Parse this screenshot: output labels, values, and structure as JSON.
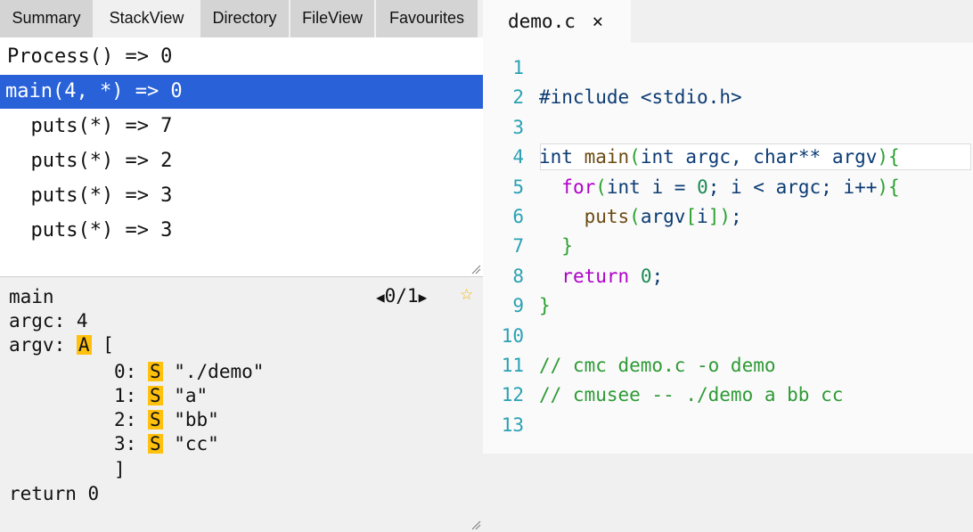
{
  "tabs": [
    "Summary",
    "StackView",
    "Directory",
    "FileView",
    "Favourites"
  ],
  "active_tab": "StackView",
  "stack": {
    "rows": [
      "Process() => 0",
      "main(4, *) => 0",
      "  puts(*) => 7",
      "  puts(*) => 2",
      "  puts(*) => 3",
      "  puts(*) => 3"
    ],
    "selected_index": 1
  },
  "vars": {
    "frame_name": "main",
    "nav_prev": "◀",
    "nav_value": "0/1",
    "nav_next": "▶",
    "star": "☆",
    "argc_label": "argc: ",
    "argc_value": "4",
    "argv_label": "argv: ",
    "argv_badge": "A",
    "argv_open": "[",
    "argv_items": [
      {
        "index": "0: ",
        "badge": "S",
        "value": "\"./demo\""
      },
      {
        "index": "1: ",
        "badge": "S",
        "value": "\"a\""
      },
      {
        "index": "2: ",
        "badge": "S",
        "value": "\"bb\""
      },
      {
        "index": "3: ",
        "badge": "S",
        "value": "\"cc\""
      }
    ],
    "argv_close": "]",
    "return_text": "return 0"
  },
  "editor": {
    "tab_label": "demo.c",
    "close_glyph": "×",
    "line_numbers": [
      "1",
      "2",
      "3",
      "4",
      "5",
      "6",
      "7",
      "8",
      "9",
      "10",
      "11",
      "12",
      "13"
    ],
    "current_line": 4,
    "code": {
      "l2_include": "#include",
      "l2_header": "<stdio.h>",
      "l4_int1": "int",
      "l4_main": "main",
      "l4_int2": "int",
      "l4_argc": "argc",
      "l4_char": "char**",
      "l4_argv": "argv",
      "l5_for": "for",
      "l5_int": "int",
      "l5_rest1": "i = ",
      "l5_zero": "0",
      "l5_rest2": "; i < argc; i++",
      "l6_puts": "puts",
      "l6_args": "argv",
      "l6_i": "i",
      "l8_return": "return",
      "l8_zero": "0",
      "l11_comment": "// cmc demo.c -o demo",
      "l12_comment": "// cmusee -- ./demo a bb cc"
    }
  },
  "colors": {
    "selection": "#2962d8",
    "badge": "#ffc10d",
    "keyword": "#b000c9",
    "line_number": "#2aa1b3",
    "comment": "#2f9a36"
  }
}
